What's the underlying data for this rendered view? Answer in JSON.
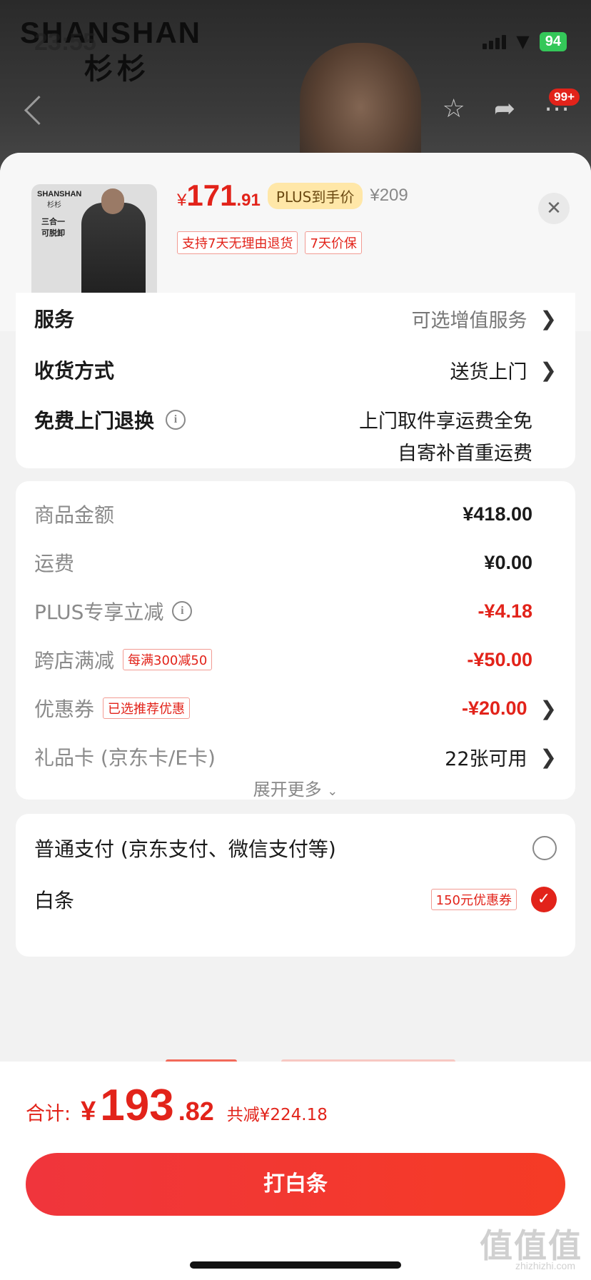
{
  "background": {
    "brand": "SHANSHAN",
    "brand_cn": "杉杉",
    "status_time": "23:55",
    "battery": "94",
    "cart_badge": "99+"
  },
  "product": {
    "price_symbol": "¥",
    "price_int": "171",
    "price_dec": ".91",
    "plus_tag": "PLUS到手价",
    "original_price": "¥209",
    "tags": [
      "支持7天无理由退货",
      "7天价保"
    ],
    "thumb_brand": "SHANSHAN",
    "thumb_brand_cn": "杉杉",
    "thumb_line1": "三合一",
    "thumb_line2": "可脱卸",
    "close_icon": "close-icon"
  },
  "services": {
    "service_label": "服务",
    "service_value": "可选增值服务",
    "delivery_label": "收货方式",
    "delivery_value": "送货上门",
    "return_label": "免费上门退换",
    "return_value_1": "上门取件享运费全免",
    "return_value_2": "自寄补首重运费"
  },
  "summary": {
    "goods_label": "商品金额",
    "goods_value": "¥418.00",
    "shipping_label": "运费",
    "shipping_value": "¥0.00",
    "plus_label": "PLUS专享立减",
    "plus_value": "-¥4.18",
    "cross_label": "跨店满减",
    "cross_tag": "每满300减50",
    "cross_value": "-¥50.00",
    "coupon_label": "优惠券",
    "coupon_tag": "已选推荐优惠",
    "coupon_value": "-¥20.00",
    "gift_label": "礼品卡 (京东卡/E卡)",
    "gift_value": "22张可用",
    "expand_label": "展开更多",
    "expand_icon": "chevron-down-icon"
  },
  "payment": {
    "normal_label": "普通支付 (京东支付、微信支付等)",
    "baitiao_label": "白条",
    "baitiao_tag": "150元优惠券"
  },
  "footer": {
    "total_label": "合计:",
    "total_symbol": "¥",
    "total_int": "193",
    "total_dec": ".82",
    "total_saved": "共减¥224.18",
    "pay_button": "打白条",
    "watermark": "值值值",
    "watermark_sub": "zhizhizhi.com"
  },
  "colors": {
    "accent_red": "#e2231a",
    "plus_gold": "#ffe7a8",
    "radio_checked": "#e2231a"
  }
}
